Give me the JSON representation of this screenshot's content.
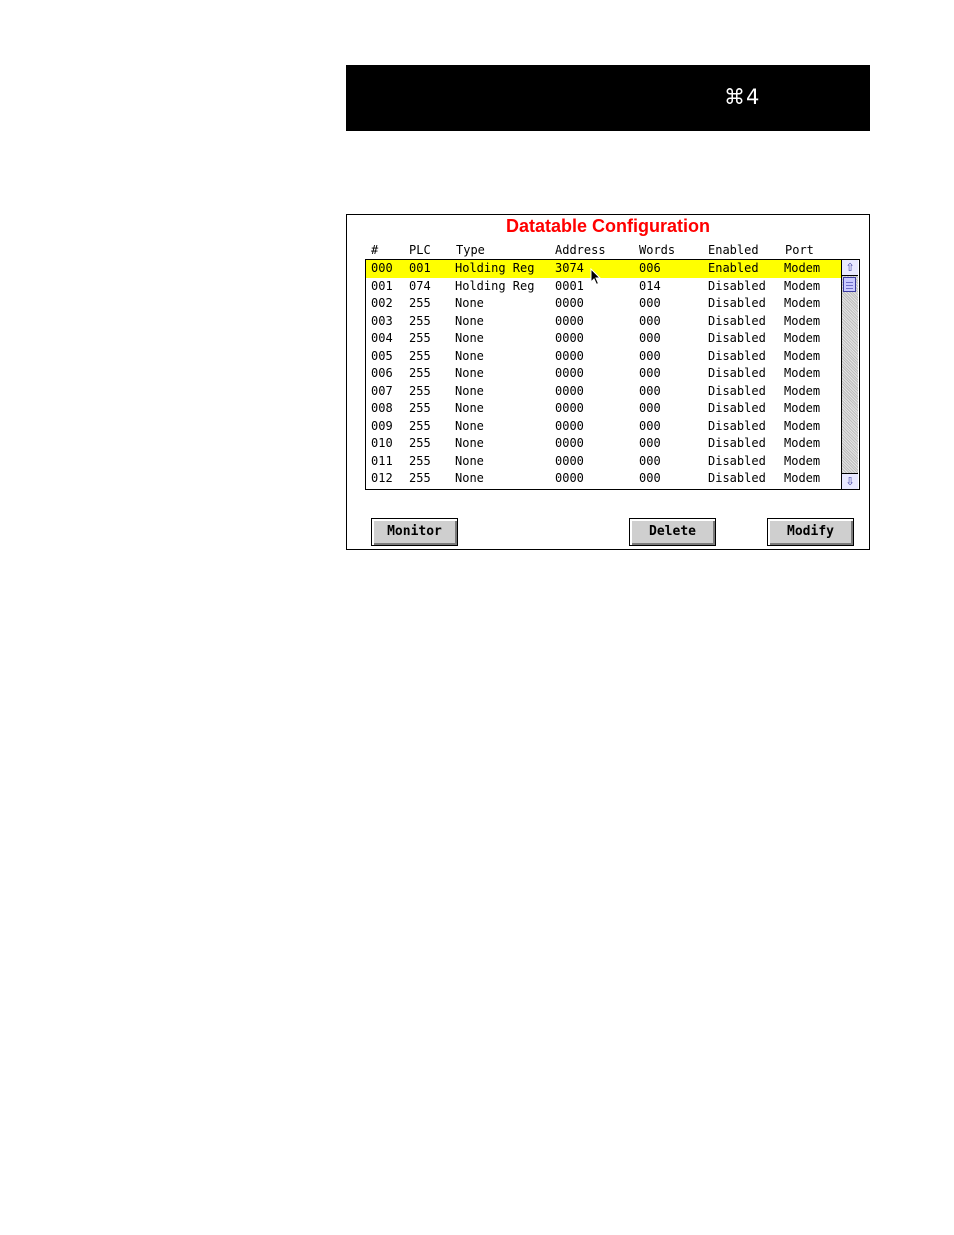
{
  "header": {
    "shortcut": "⌘4"
  },
  "window": {
    "title": "Datatable Configuration",
    "title_color": "#ff0000",
    "highlight_color": "#ffff00"
  },
  "columns": [
    "#",
    "PLC",
    "Type",
    "Address",
    "Words",
    "Enabled",
    "Port"
  ],
  "rows": [
    {
      "num": "000",
      "plc": "001",
      "type": "Holding Reg",
      "address": "3074",
      "words": "006",
      "enabled": "Enabled",
      "port": "Modem",
      "selected": true
    },
    {
      "num": "001",
      "plc": "074",
      "type": "Holding Reg",
      "address": "0001",
      "words": "014",
      "enabled": "Disabled",
      "port": "Modem"
    },
    {
      "num": "002",
      "plc": "255",
      "type": "None",
      "address": "0000",
      "words": "000",
      "enabled": "Disabled",
      "port": "Modem"
    },
    {
      "num": "003",
      "plc": "255",
      "type": "None",
      "address": "0000",
      "words": "000",
      "enabled": "Disabled",
      "port": "Modem"
    },
    {
      "num": "004",
      "plc": "255",
      "type": "None",
      "address": "0000",
      "words": "000",
      "enabled": "Disabled",
      "port": "Modem"
    },
    {
      "num": "005",
      "plc": "255",
      "type": "None",
      "address": "0000",
      "words": "000",
      "enabled": "Disabled",
      "port": "Modem"
    },
    {
      "num": "006",
      "plc": "255",
      "type": "None",
      "address": "0000",
      "words": "000",
      "enabled": "Disabled",
      "port": "Modem"
    },
    {
      "num": "007",
      "plc": "255",
      "type": "None",
      "address": "0000",
      "words": "000",
      "enabled": "Disabled",
      "port": "Modem"
    },
    {
      "num": "008",
      "plc": "255",
      "type": "None",
      "address": "0000",
      "words": "000",
      "enabled": "Disabled",
      "port": "Modem"
    },
    {
      "num": "009",
      "plc": "255",
      "type": "None",
      "address": "0000",
      "words": "000",
      "enabled": "Disabled",
      "port": "Modem"
    },
    {
      "num": "010",
      "plc": "255",
      "type": "None",
      "address": "0000",
      "words": "000",
      "enabled": "Disabled",
      "port": "Modem"
    },
    {
      "num": "011",
      "plc": "255",
      "type": "None",
      "address": "0000",
      "words": "000",
      "enabled": "Disabled",
      "port": "Modem"
    },
    {
      "num": "012",
      "plc": "255",
      "type": "None",
      "address": "0000",
      "words": "000",
      "enabled": "Disabled",
      "port": "Modem"
    }
  ],
  "scrollbar": {
    "up_icon": "arrow-up-icon",
    "down_icon": "arrow-down-icon"
  },
  "buttons": {
    "monitor": "Monitor",
    "delete": "Delete",
    "modify": "Modify"
  },
  "cursor_icon": "mouse-pointer-icon"
}
